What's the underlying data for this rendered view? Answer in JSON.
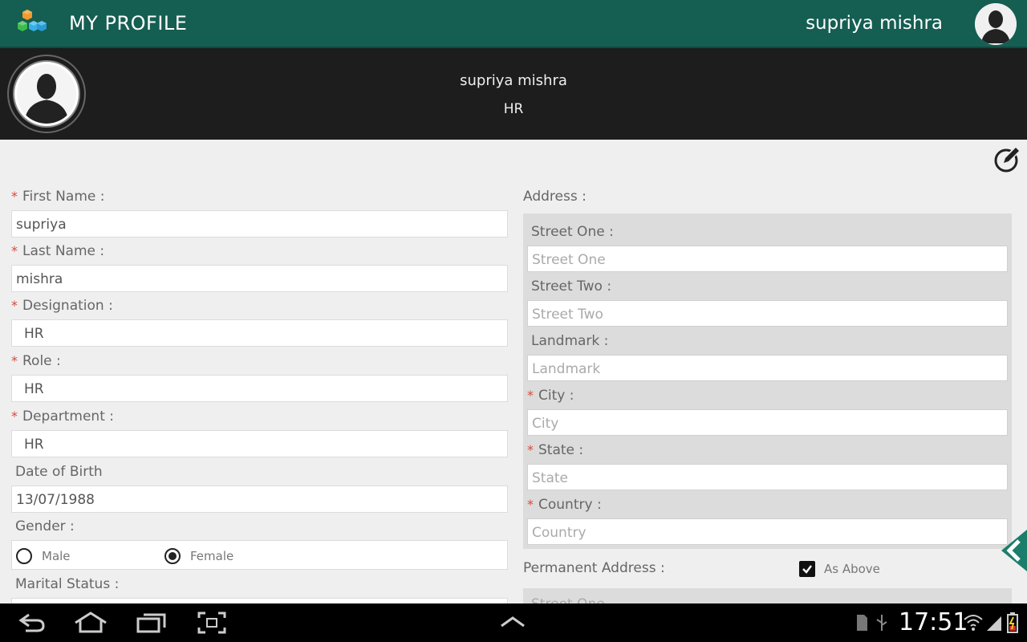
{
  "header": {
    "title": "MY PROFILE",
    "user_name": "supriya mishra"
  },
  "profile": {
    "name": "supriya mishra",
    "role": "HR"
  },
  "form": {
    "first_name_label": "First Name :",
    "first_name": "supriya",
    "last_name_label": "Last Name :",
    "last_name": "mishra",
    "designation_label": "Designation :",
    "designation": "HR",
    "role_label": "Role :",
    "role": "HR",
    "department_label": "Department :",
    "department": "HR",
    "dob_label": "Date of Birth",
    "dob": "13/07/1988",
    "gender_label": "Gender :",
    "gender_male": "Male",
    "gender_female": "Female",
    "gender_selected": "Female",
    "marital_label": "Marital Status :",
    "required_mark": "*"
  },
  "address": {
    "label": "Address :",
    "street_one_label": "Street One :",
    "street_one_placeholder": "Street One",
    "street_two_label": "Street Two :",
    "street_two_placeholder": "Street Two",
    "landmark_label": "Landmark :",
    "landmark_placeholder": "Landmark",
    "city_label": "City :",
    "city_placeholder": "City",
    "state_label": "State :",
    "state_placeholder": "State",
    "country_label": "Country :",
    "country_placeholder": "Country",
    "permanent_label": "Permanent Address :",
    "as_above_label": "As Above",
    "as_above_checked": true,
    "permanent_street_one_placeholder": "Street One"
  },
  "status_bar": {
    "time": "17:51"
  },
  "colors": {
    "app_bar": "#155e52",
    "profile_header": "#1d1d1d",
    "required": "#d64a3a",
    "accent_arrow": "#1b7e6a"
  }
}
